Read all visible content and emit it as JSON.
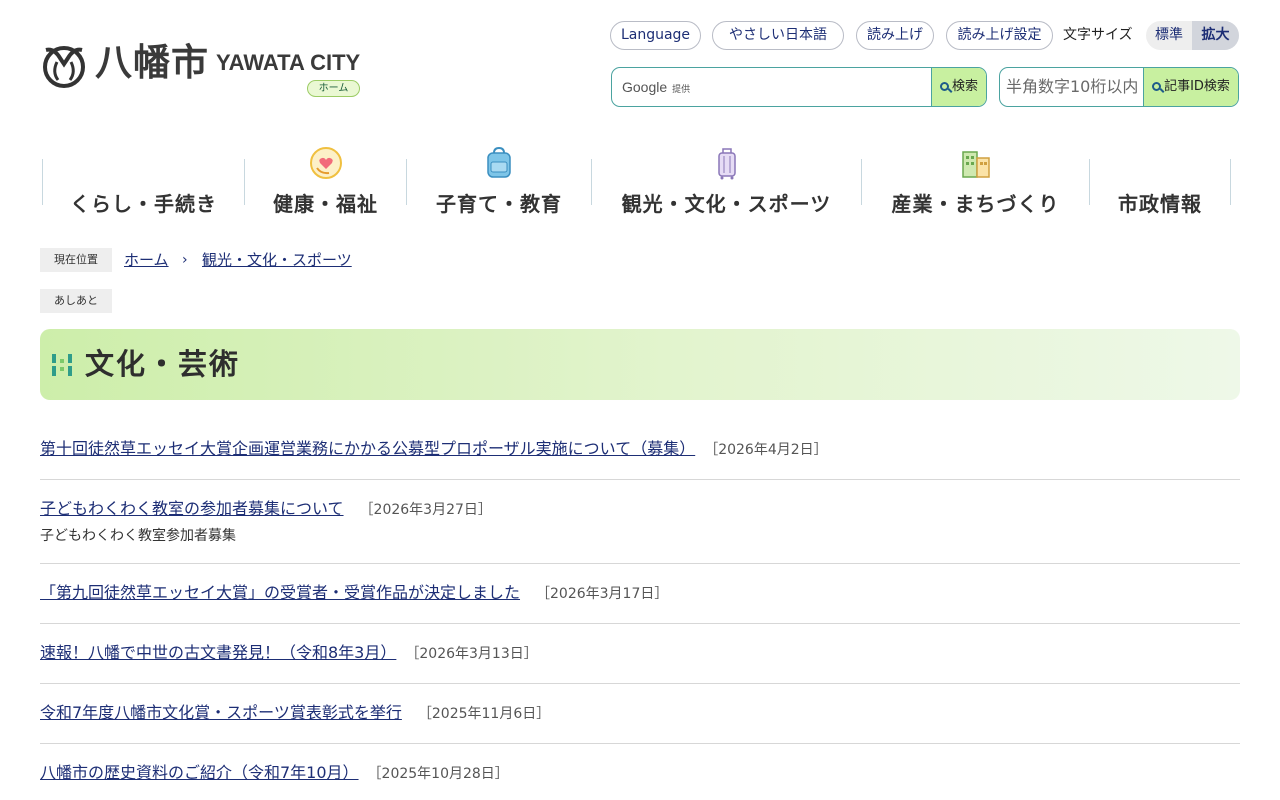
{
  "header": {
    "logo_jp": "八幡市",
    "logo_en": "YAWATA CITY",
    "home_pill": "ホーム",
    "utility": {
      "language": "Language",
      "easy_japanese": "やさしい日本語",
      "read_aloud": "読み上げ",
      "read_settings": "読み上げ設定",
      "font_size_label": "文字サイズ",
      "font_standard": "標準",
      "font_large": "拡大"
    },
    "search": {
      "brand": "Google",
      "brand_sub": "提供",
      "button": "検索"
    },
    "article_id": {
      "placeholder": "半角数字10桁以内",
      "button": "記事ID検索"
    }
  },
  "nav": [
    {
      "label": "くらし・手続き",
      "icon": "none"
    },
    {
      "label": "健康・福祉",
      "icon": "heart-hand-icon"
    },
    {
      "label": "子育て・教育",
      "icon": "backpack-icon"
    },
    {
      "label": "観光・文化・スポーツ",
      "icon": "suitcase-icon"
    },
    {
      "label": "産業・まちづくり",
      "icon": "buildings-icon"
    },
    {
      "label": "市政情報",
      "icon": "none"
    }
  ],
  "breadcrumb": {
    "tag": "現在位置",
    "home": "ホーム",
    "separator": "›",
    "current": "観光・文化・スポーツ",
    "ashiato": "あしあと"
  },
  "page": {
    "title": "文化・芸術"
  },
  "news": [
    {
      "title": "第十回徒然草エッセイ大賞企画運営業務にかかる公募型プロポーザル実施について（募集）",
      "date": "［2026年4月2日］",
      "desc": ""
    },
    {
      "title": "子どもわくわく教室の参加者募集について",
      "date": "［2026年3月27日］",
      "desc": "子どもわくわく教室参加者募集"
    },
    {
      "title": "「第九回徒然草エッセイ大賞」の受賞者・受賞作品が決定しました",
      "date": "［2026年3月17日］",
      "desc": ""
    },
    {
      "title": "速報！八幡で中世の古文書発見！（令和8年3月）",
      "date": "［2026年3月13日］",
      "desc": ""
    },
    {
      "title": "令和7年度八幡市文化賞・スポーツ賞表彰式を挙行",
      "date": "［2025年11月6日］",
      "desc": ""
    },
    {
      "title": "八幡市の歴史資料のご紹介（令和7年10月）",
      "date": "［2025年10月28日］",
      "desc": ""
    }
  ],
  "colors": {
    "link": "#1d2e75",
    "accent_green": "#c8f0a0",
    "search_border": "#4ba3a0"
  }
}
